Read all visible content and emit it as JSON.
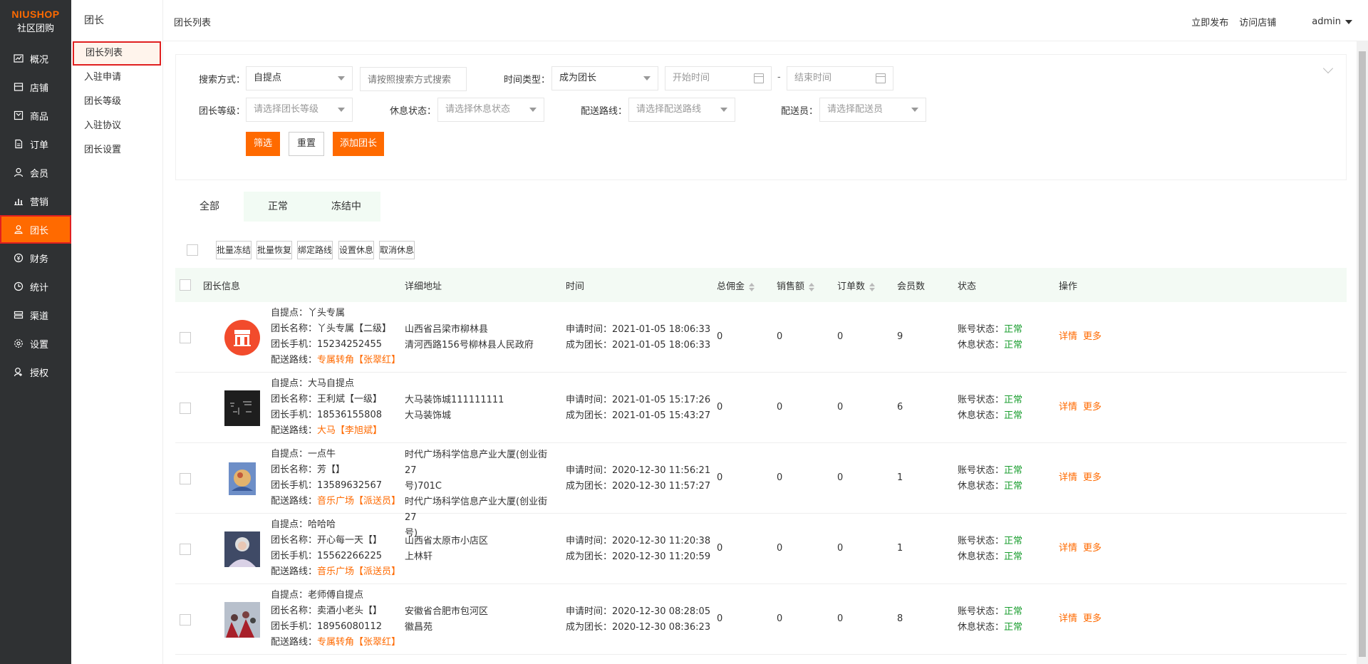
{
  "brand": {
    "en": "NIUSHOP",
    "cn": "社区团购"
  },
  "nav": [
    {
      "label": "概况",
      "icon": "chart-icon"
    },
    {
      "label": "店铺",
      "icon": "store-icon"
    },
    {
      "label": "商品",
      "icon": "goods-icon"
    },
    {
      "label": "订单",
      "icon": "order-icon"
    },
    {
      "label": "会员",
      "icon": "member-icon"
    },
    {
      "label": "营销",
      "icon": "marketing-icon"
    },
    {
      "label": "团长",
      "icon": "leader-icon"
    },
    {
      "label": "财务",
      "icon": "finance-icon"
    },
    {
      "label": "统计",
      "icon": "stats-icon"
    },
    {
      "label": "渠道",
      "icon": "channel-icon"
    },
    {
      "label": "设置",
      "icon": "settings-icon"
    },
    {
      "label": "授权",
      "icon": "auth-icon"
    }
  ],
  "subnav": {
    "title": "团长",
    "items": [
      "团长列表",
      "入驻申请",
      "团长等级",
      "入驻协议",
      "团长设置"
    ]
  },
  "header": {
    "breadcrumb": "团长列表",
    "publish": "立即发布",
    "visit": "访问店铺",
    "user": "admin"
  },
  "filter": {
    "search_label": "搜索方式：",
    "search_type": "自提点",
    "search_placeholder": "请按照搜索方式搜索",
    "time_label": "时间类型：",
    "time_type": "成为团长",
    "start_placeholder": "开始时间",
    "dash": "-",
    "end_placeholder": "结束时间",
    "level_label": "团长等级：",
    "level_placeholder": "请选择团长等级",
    "rest_label": "休息状态：",
    "rest_placeholder": "请选择休息状态",
    "route_label": "配送路线：",
    "route_placeholder": "请选择配送路线",
    "courier_label": "配送员：",
    "courier_placeholder": "请选择配送员",
    "btn_filter": "筛选",
    "btn_reset": "重置",
    "btn_add": "添加团长"
  },
  "tabs": [
    "全部",
    "正常",
    "冻结中"
  ],
  "batch": [
    "批量冻结",
    "批量恢复",
    "绑定路线",
    "设置休息",
    "取消休息"
  ],
  "table": {
    "headers": {
      "info": "团长信息",
      "address": "详细地址",
      "time": "时间",
      "commission": "总佣金",
      "sales": "销售额",
      "orders": "订单数",
      "members": "会员数",
      "status": "状态",
      "ops": "操作"
    },
    "prefix": {
      "pickup": "自提点：",
      "name": "团长名称：",
      "phone": "团长手机：",
      "route": "配送路线：",
      "apply": "申请时间：",
      "become": "成为团长：",
      "account": "账号状态：",
      "rest": "休息状态："
    },
    "rows": [
      {
        "pickup": "丫头专属",
        "name": "丫头专属【二级】",
        "phone": "15234252455",
        "route": "专属转角",
        "courier": "张翠红",
        "address": [
          "山西省吕梁市柳林县",
          "清河西路156号柳林县人民政府"
        ],
        "apply": "2021-01-05 18:06:33",
        "become": "2021-01-05 18:06:33",
        "commission": "0",
        "sales": "0",
        "orders": "0",
        "members": "9",
        "account": "正常",
        "rest": "正常",
        "avatar": "store-avatar"
      },
      {
        "pickup": "大马自提点",
        "name": "王利斌【一级】",
        "phone": "18536155808",
        "route": "大马",
        "courier": "李旭斌",
        "address": [
          "大马装饰城111111111",
          "大马装饰城"
        ],
        "apply": "2021-01-05 15:17:26",
        "become": "2021-01-05 15:43:27",
        "commission": "0",
        "sales": "0",
        "orders": "0",
        "members": "6",
        "account": "正常",
        "rest": "正常",
        "avatar": "calligraphy-avatar"
      },
      {
        "pickup": "一点牛",
        "name": "芳【】",
        "phone": "13589632567",
        "route": "音乐广场",
        "courier": "派送员",
        "address": [
          "时代广场科学信息产业大厦(创业街27",
          "号)701C",
          "时代广场科学信息产业大厦(创业街27",
          "号)"
        ],
        "apply": "2020-12-30 11:56:21",
        "become": "2020-12-30 11:57:27",
        "commission": "0",
        "sales": "0",
        "orders": "0",
        "members": "1",
        "account": "正常",
        "rest": "正常",
        "avatar": "painting-avatar"
      },
      {
        "pickup": "哈哈哈",
        "name": "开心每一天【】",
        "phone": "15562266225",
        "route": "音乐广场",
        "courier": "派送员",
        "address": [
          "山西省太原市小店区",
          "上林轩"
        ],
        "apply": "2020-12-30 11:20:38",
        "become": "2020-12-30 11:20:59",
        "commission": "0",
        "sales": "0",
        "orders": "0",
        "members": "1",
        "account": "正常",
        "rest": "正常",
        "avatar": "portrait-avatar"
      },
      {
        "pickup": "老师傅自提点",
        "name": "卖酒小老头【】",
        "phone": "18956080112",
        "route": "专属转角",
        "courier": "张翠红",
        "address": [
          "安徽省合肥市包河区",
          "徽昌苑"
        ],
        "apply": "2020-12-30 08:28:05",
        "become": "2020-12-30 08:36:23",
        "commission": "0",
        "sales": "0",
        "orders": "0",
        "members": "8",
        "account": "正常",
        "rest": "正常",
        "avatar": "crowd-avatar"
      }
    ],
    "ops": {
      "detail": "详情",
      "more": "更多"
    }
  },
  "colors": {
    "accent": "#ff6a00",
    "nav_bg": "#2f3133",
    "ok": "#1a9e2f",
    "head_bg": "#f3faf4"
  }
}
